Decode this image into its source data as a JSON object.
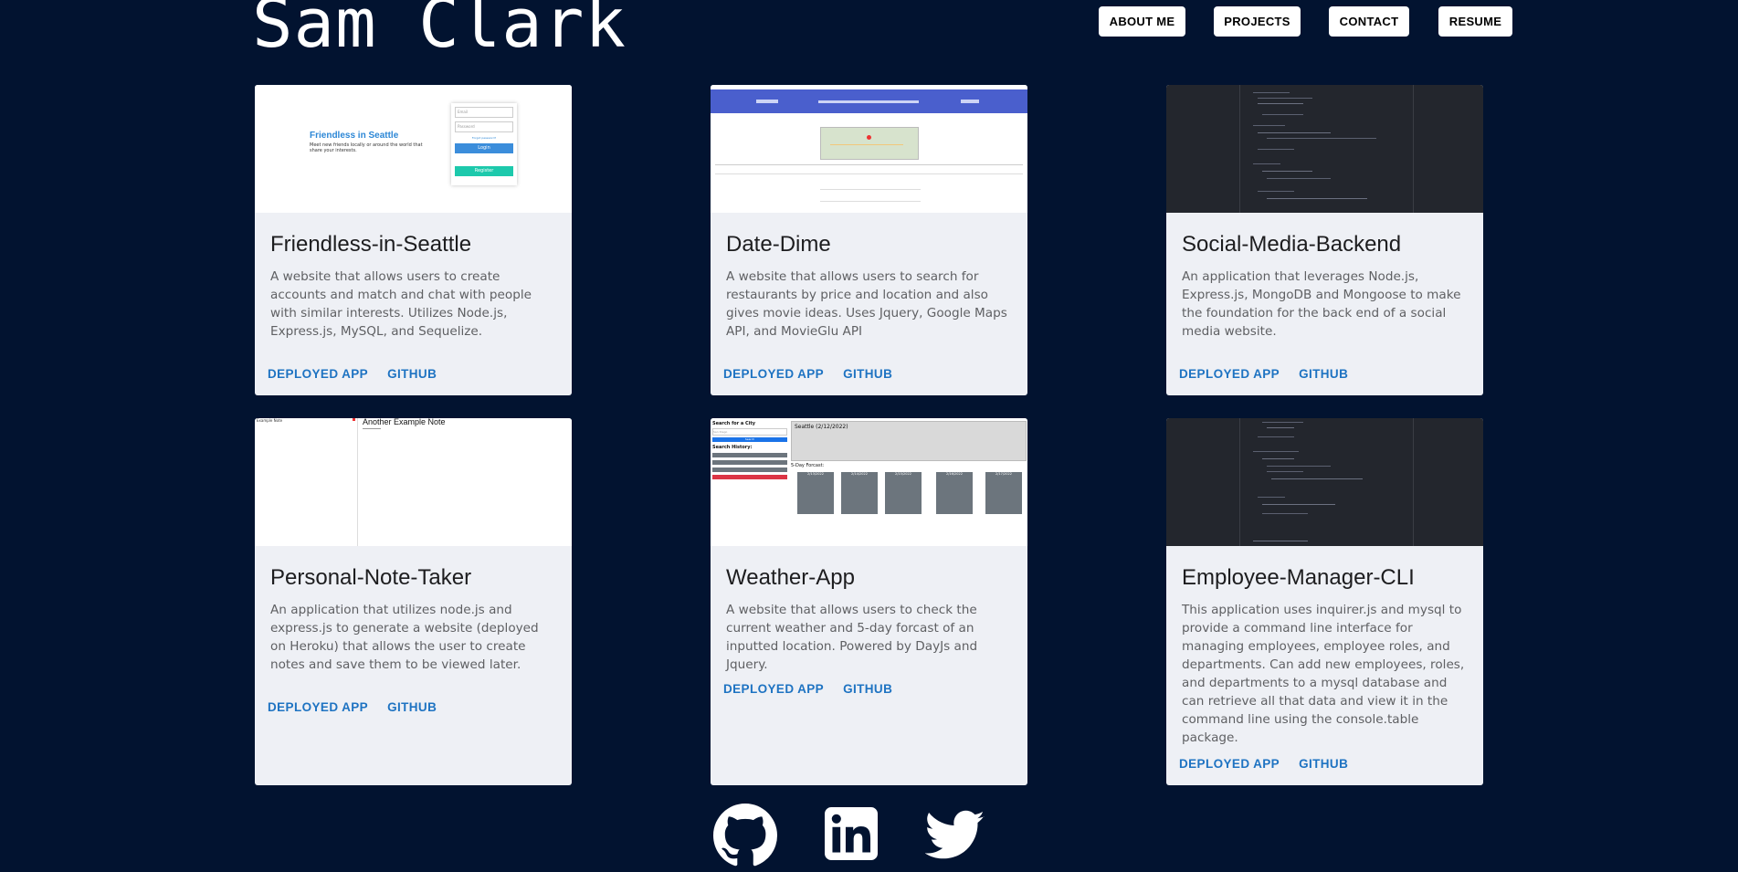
{
  "header": {
    "name": "Sam Clark"
  },
  "nav": {
    "about": "ABOUT ME",
    "projects": "PROJECTS",
    "contact": "CONTACT",
    "resume": "RESUME"
  },
  "projects": [
    {
      "title": "Friendless-in-Seattle",
      "description": "A website that allows users to create accounts and match and chat with people with similar interests. Utilizes Node.js, Express.js, MySQL, and Sequelize.",
      "deployed_label": "DEPLOYED APP",
      "github_label": "GITHUB",
      "thumb": {
        "heading": "Friendless in Seattle",
        "subtext": "Meet new friends locally or around the world that share your interests.",
        "email_placeholder": "Email",
        "password_placeholder": "Password",
        "forgot": "Forgot password?",
        "login": "Login",
        "register": "Register"
      }
    },
    {
      "title": "Date-Dime",
      "description": "A website that allows users to search for restaurants by price and location and also gives movie ideas. Uses Jquery, Google Maps API, and MovieGlu API",
      "deployed_label": "DEPLOYED APP",
      "github_label": "GITHUB"
    },
    {
      "title": "Social-Media-Backend",
      "description": "An application that leverages Node.js, Express.js, MongoDB and Mongoose to make the foundation for the back end of a social media website.",
      "deployed_label": "DEPLOYED APP",
      "github_label": "GITHUB"
    },
    {
      "title": "Personal-Note-Taker",
      "description": "An application that utilizes node.js and express.js to generate a website (deployed on Heroku) that allows the user to create notes and save them to be viewed later.",
      "deployed_label": "DEPLOYED APP",
      "github_label": "GITHUB",
      "thumb": {
        "list_item": "Example Note",
        "note_title": "Another Example Note"
      }
    },
    {
      "title": "Weather-App",
      "description": "A website that allows users to check the current weather and 5-day forcast of an inputted location. Powered by DayJs and Jquery.",
      "deployed_label": "DEPLOYED APP",
      "github_label": "GITHUB",
      "thumb": {
        "search_heading": "Search for a City",
        "search_placeholder": "San Diego",
        "search_button": "Search",
        "history_heading": "Search History:",
        "current_city": "Seattle (2/12/2022)",
        "forecast_heading": "5-Day Forcast:",
        "forecast_dates": [
          "2/13/2022",
          "2/14/2022",
          "2/15/2022",
          "2/16/2022",
          "2/17/2022"
        ]
      }
    },
    {
      "title": "Employee-Manager-CLI",
      "description": "This application uses inquirer.js and mysql to provide a command line interface for managing employees, employee roles, and departments. Can add new employees, roles, and departments to a mysql database and can retrieve all that data and view it in the command line using the console.table package.",
      "deployed_label": "DEPLOYED APP",
      "github_label": "GITHUB"
    }
  ],
  "colors": {
    "background": "#021330",
    "card": "#eef0f5",
    "link": "#1e73c2"
  },
  "footer": {
    "icons": [
      "github-icon",
      "linkedin-icon",
      "twitter-icon"
    ]
  }
}
